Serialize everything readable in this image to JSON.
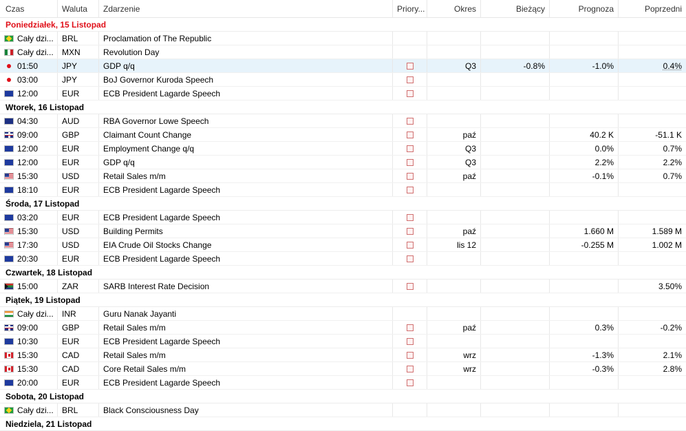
{
  "columns": {
    "time": "Czas",
    "currency": "Waluta",
    "event": "Zdarzenie",
    "priority": "Priory...",
    "period": "Okres",
    "actual": "Bieżący",
    "forecast": "Prognoza",
    "previous": "Poprzedni"
  },
  "rows": [
    {
      "type": "day",
      "label": "Poniedziałek, 15 Listopad",
      "today": true
    },
    {
      "type": "event",
      "icon": "flag-br",
      "time": "Cały dzi...",
      "currency": "BRL",
      "event": "Proclamation of The Republic",
      "priority": false,
      "period": "",
      "actual": "",
      "forecast": "",
      "previous": ""
    },
    {
      "type": "event",
      "icon": "flag-mx",
      "time": "Cały dzi...",
      "currency": "MXN",
      "event": "Revolution Day",
      "priority": false,
      "period": "",
      "actual": "",
      "forecast": "",
      "previous": ""
    },
    {
      "type": "event",
      "icon": "dot",
      "time": "01:50",
      "currency": "JPY",
      "event": "GDP q/q",
      "priority": true,
      "period": "Q3",
      "actual": "-0.8%",
      "forecast": "-1.0%",
      "previous": "0.4%",
      "selected": true
    },
    {
      "type": "event",
      "icon": "dot",
      "time": "03:00",
      "currency": "JPY",
      "event": "BoJ Governor Kuroda Speech",
      "priority": true,
      "period": "",
      "actual": "",
      "forecast": "",
      "previous": ""
    },
    {
      "type": "event",
      "icon": "flag-eu",
      "time": "12:00",
      "currency": "EUR",
      "event": "ECB President Lagarde Speech",
      "priority": true,
      "period": "",
      "actual": "",
      "forecast": "",
      "previous": ""
    },
    {
      "type": "day",
      "label": "Wtorek, 16 Listopad"
    },
    {
      "type": "event",
      "icon": "flag-au",
      "time": "04:30",
      "currency": "AUD",
      "event": "RBA Governor Lowe Speech",
      "priority": true,
      "period": "",
      "actual": "",
      "forecast": "",
      "previous": ""
    },
    {
      "type": "event",
      "icon": "flag-gb",
      "time": "09:00",
      "currency": "GBP",
      "event": "Claimant Count Change",
      "priority": true,
      "period": "paź",
      "actual": "",
      "forecast": "40.2 K",
      "previous": "-51.1 K"
    },
    {
      "type": "event",
      "icon": "flag-eu",
      "time": "12:00",
      "currency": "EUR",
      "event": "Employment Change q/q",
      "priority": true,
      "period": "Q3",
      "actual": "",
      "forecast": "0.0%",
      "previous": "0.7%"
    },
    {
      "type": "event",
      "icon": "flag-eu",
      "time": "12:00",
      "currency": "EUR",
      "event": "GDP q/q",
      "priority": true,
      "period": "Q3",
      "actual": "",
      "forecast": "2.2%",
      "previous": "2.2%"
    },
    {
      "type": "event",
      "icon": "flag-us",
      "time": "15:30",
      "currency": "USD",
      "event": "Retail Sales m/m",
      "priority": true,
      "period": "paź",
      "actual": "",
      "forecast": "-0.1%",
      "previous": "0.7%"
    },
    {
      "type": "event",
      "icon": "flag-eu",
      "time": "18:10",
      "currency": "EUR",
      "event": "ECB President Lagarde Speech",
      "priority": true,
      "period": "",
      "actual": "",
      "forecast": "",
      "previous": ""
    },
    {
      "type": "day",
      "label": "Środa, 17 Listopad"
    },
    {
      "type": "event",
      "icon": "flag-eu",
      "time": "03:20",
      "currency": "EUR",
      "event": "ECB President Lagarde Speech",
      "priority": true,
      "period": "",
      "actual": "",
      "forecast": "",
      "previous": ""
    },
    {
      "type": "event",
      "icon": "flag-us",
      "time": "15:30",
      "currency": "USD",
      "event": "Building Permits",
      "priority": true,
      "period": "paź",
      "actual": "",
      "forecast": "1.660 M",
      "previous": "1.589 M"
    },
    {
      "type": "event",
      "icon": "flag-us",
      "time": "17:30",
      "currency": "USD",
      "event": "EIA Crude Oil Stocks Change",
      "priority": true,
      "period": "lis 12",
      "actual": "",
      "forecast": "-0.255 M",
      "previous": "1.002 M"
    },
    {
      "type": "event",
      "icon": "flag-eu",
      "time": "20:30",
      "currency": "EUR",
      "event": "ECB President Lagarde Speech",
      "priority": true,
      "period": "",
      "actual": "",
      "forecast": "",
      "previous": ""
    },
    {
      "type": "day",
      "label": "Czwartek, 18 Listopad"
    },
    {
      "type": "event",
      "icon": "flag-za",
      "time": "15:00",
      "currency": "ZAR",
      "event": "SARB Interest Rate Decision",
      "priority": true,
      "period": "",
      "actual": "",
      "forecast": "",
      "previous": "3.50%"
    },
    {
      "type": "day",
      "label": "Piątek, 19 Listopad"
    },
    {
      "type": "event",
      "icon": "flag-in",
      "time": "Cały dzi...",
      "currency": "INR",
      "event": "Guru Nanak Jayanti",
      "priority": false,
      "period": "",
      "actual": "",
      "forecast": "",
      "previous": ""
    },
    {
      "type": "event",
      "icon": "flag-gb",
      "time": "09:00",
      "currency": "GBP",
      "event": "Retail Sales m/m",
      "priority": true,
      "period": "paź",
      "actual": "",
      "forecast": "0.3%",
      "previous": "-0.2%"
    },
    {
      "type": "event",
      "icon": "flag-eu",
      "time": "10:30",
      "currency": "EUR",
      "event": "ECB President Lagarde Speech",
      "priority": true,
      "period": "",
      "actual": "",
      "forecast": "",
      "previous": ""
    },
    {
      "type": "event",
      "icon": "flag-ca",
      "time": "15:30",
      "currency": "CAD",
      "event": "Retail Sales m/m",
      "priority": true,
      "period": "wrz",
      "actual": "",
      "forecast": "-1.3%",
      "previous": "2.1%"
    },
    {
      "type": "event",
      "icon": "flag-ca",
      "time": "15:30",
      "currency": "CAD",
      "event": "Core Retail Sales m/m",
      "priority": true,
      "period": "wrz",
      "actual": "",
      "forecast": "-0.3%",
      "previous": "2.8%"
    },
    {
      "type": "event",
      "icon": "flag-eu",
      "time": "20:00",
      "currency": "EUR",
      "event": "ECB President Lagarde Speech",
      "priority": true,
      "period": "",
      "actual": "",
      "forecast": "",
      "previous": ""
    },
    {
      "type": "day",
      "label": "Sobota, 20 Listopad"
    },
    {
      "type": "event",
      "icon": "flag-br",
      "time": "Cały dzi...",
      "currency": "BRL",
      "event": "Black Consciousness Day",
      "priority": false,
      "period": "",
      "actual": "",
      "forecast": "",
      "previous": ""
    },
    {
      "type": "day",
      "label": "Niedziela, 21 Listopad"
    }
  ]
}
